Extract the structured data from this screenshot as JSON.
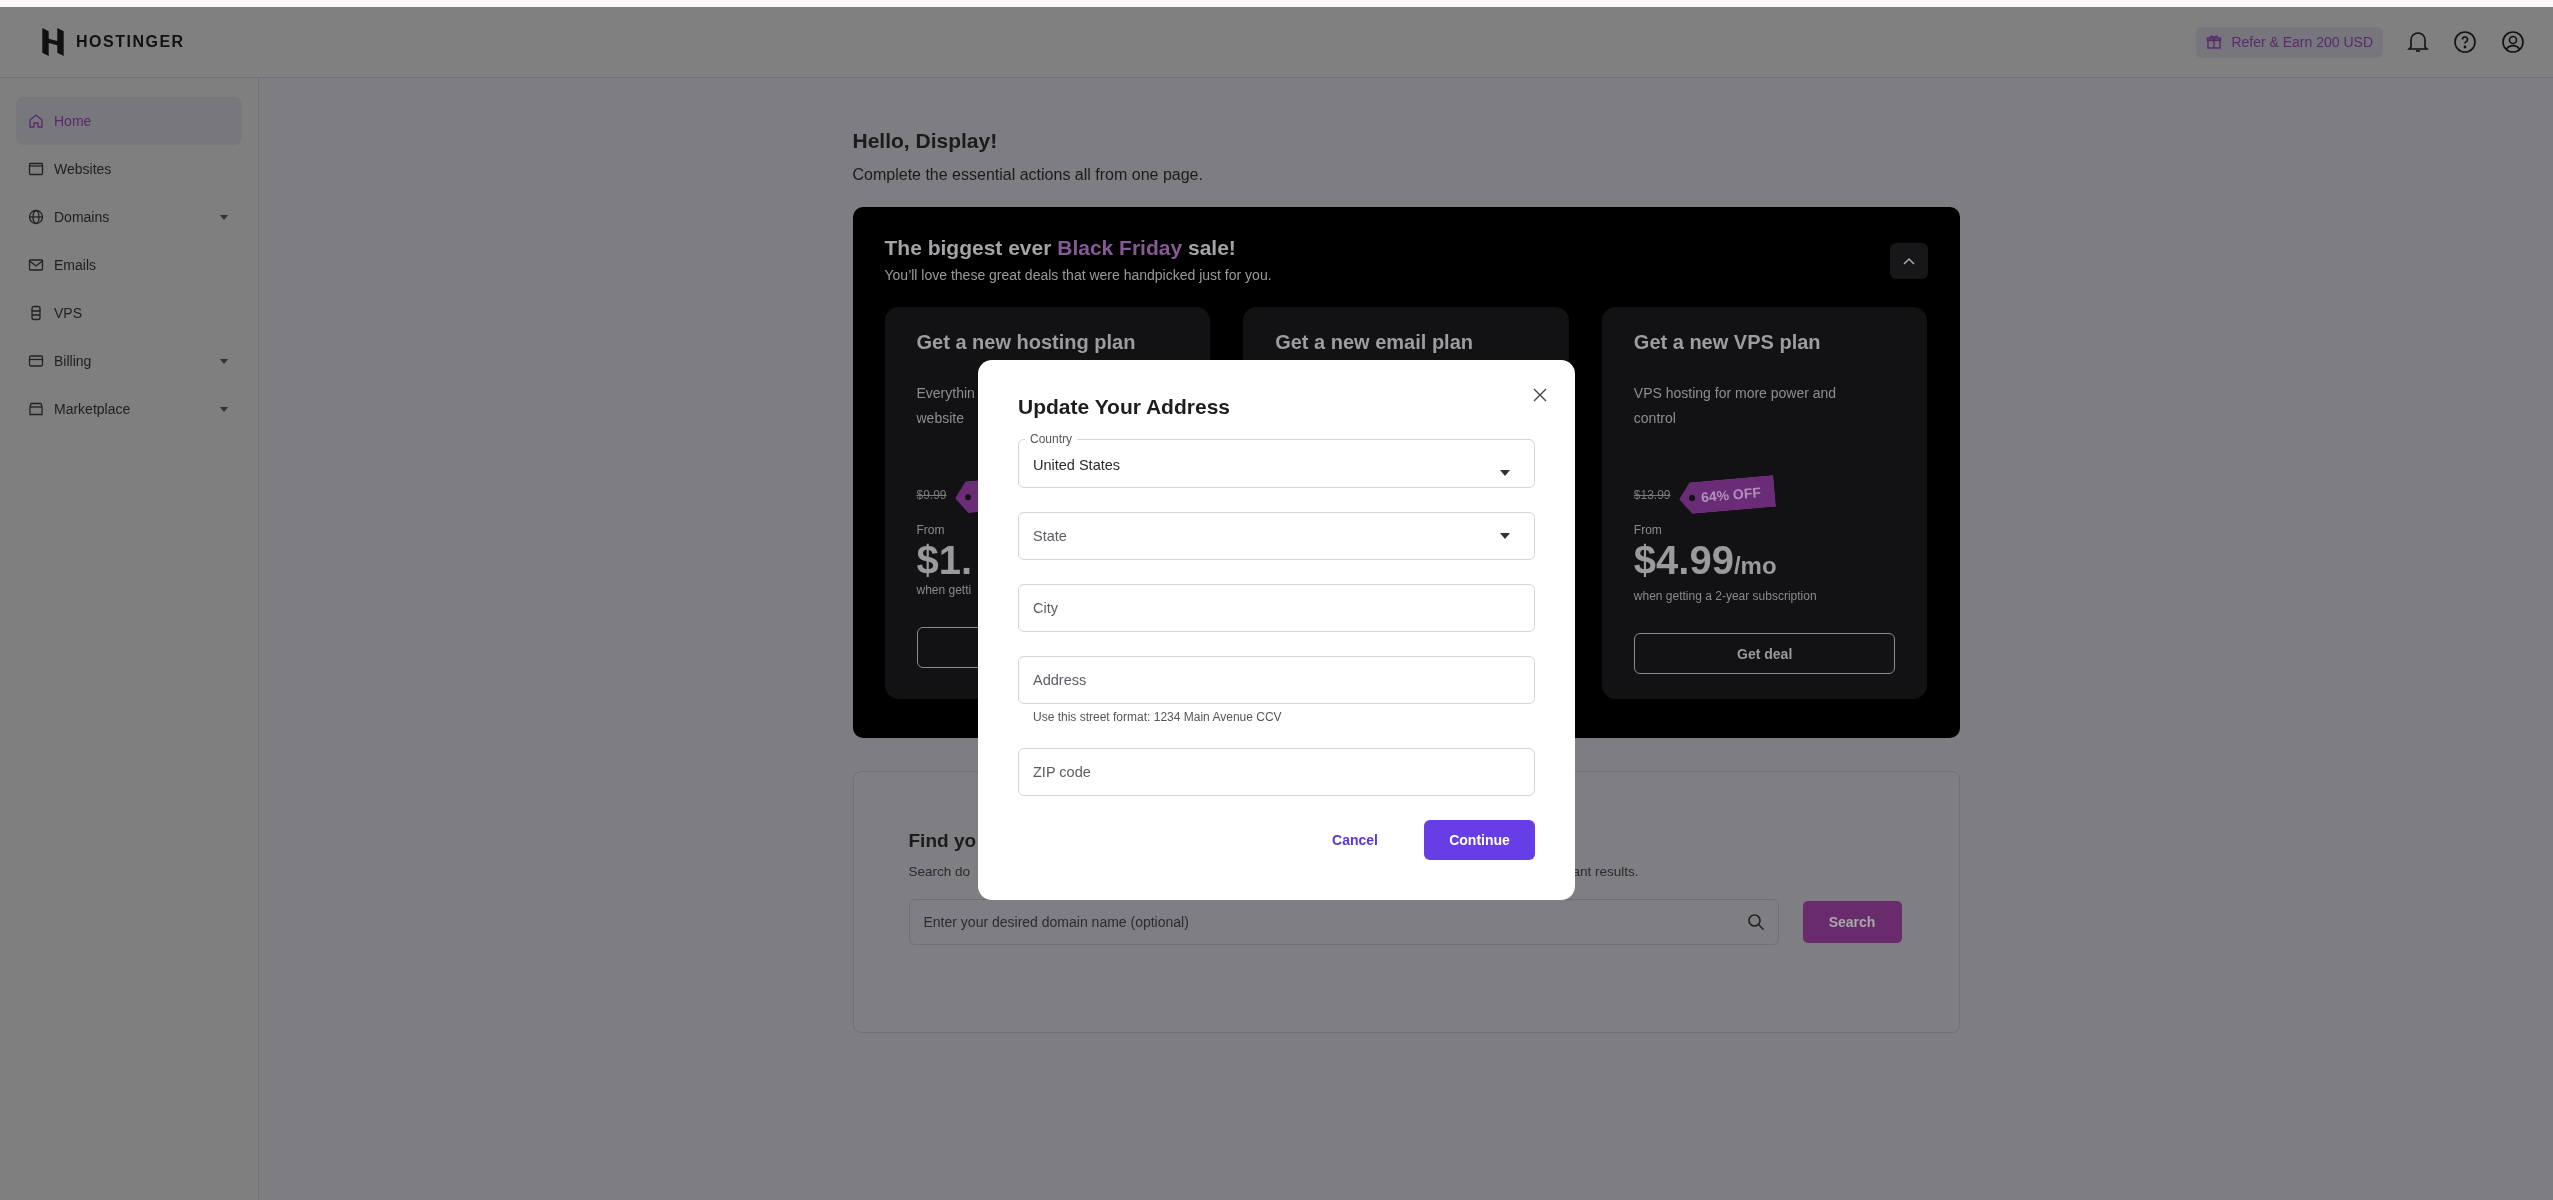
{
  "header": {
    "logo": "HOSTINGER",
    "refer": "Refer & Earn 200 USD"
  },
  "sidebar": {
    "items": [
      {
        "label": "Home",
        "selected": true,
        "has_submenu": false
      },
      {
        "label": "Websites",
        "selected": false,
        "has_submenu": false
      },
      {
        "label": "Domains",
        "selected": false,
        "has_submenu": true
      },
      {
        "label": "Emails",
        "selected": false,
        "has_submenu": false
      },
      {
        "label": "VPS",
        "selected": false,
        "has_submenu": false
      },
      {
        "label": "Billing",
        "selected": false,
        "has_submenu": true
      },
      {
        "label": "Marketplace",
        "selected": false,
        "has_submenu": true
      }
    ]
  },
  "greeting": {
    "title": "Hello, Display!",
    "subtitle": "Complete the essential actions all from one page."
  },
  "promo": {
    "title_start": "The biggest ever",
    "title_highlight": "Black Friday",
    "title_end": "sale!",
    "subtitle": "You’ll love these great deals that were handpicked just for you.",
    "expanded": true,
    "cards": [
      {
        "title": "Get a new hosting plan",
        "description": [
          "Everythin",
          "website"
        ],
        "old_price": "$9.99",
        "from": "From",
        "price": "$1.",
        "note": "when getti"
      },
      {
        "title": "Get a new email plan"
      },
      {
        "title": "Get a new VPS plan",
        "description": [
          "VPS hosting for more power and",
          "control"
        ],
        "old_price": "$13.99",
        "tag": "64% OFF",
        "from": "From",
        "price": "$4.99",
        "price_suffix": "/mo",
        "note": "when getting a 2-year subscription",
        "button": "Get deal"
      }
    ]
  },
  "domain": {
    "title": "Find yo",
    "description_start": "Search do",
    "description_end": "ant results.",
    "placeholder": "Enter your desired domain name (optional)",
    "button": "Search"
  },
  "dialog": {
    "title": "Update Your Address",
    "fields": [
      {
        "kind": "select",
        "label": "Country",
        "value": "United States"
      },
      {
        "kind": "select",
        "placeholder": "State"
      },
      {
        "kind": "text",
        "placeholder": "City"
      },
      {
        "kind": "text",
        "placeholder": "Address",
        "hint": "Use this street format: 1234 Main Avenue CCV"
      },
      {
        "kind": "text",
        "placeholder": "ZIP code"
      }
    ],
    "cancel": "Cancel",
    "continue": "Continue"
  }
}
